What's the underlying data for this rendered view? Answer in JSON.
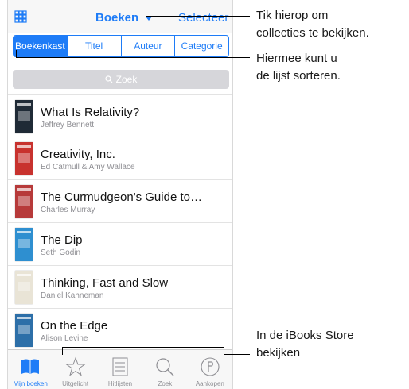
{
  "navbar": {
    "title": "Boeken",
    "right_button": "Selecteer"
  },
  "segments": [
    {
      "label": "Boekenkast",
      "active": true
    },
    {
      "label": "Titel",
      "active": false
    },
    {
      "label": "Auteur",
      "active": false
    },
    {
      "label": "Categorie",
      "active": false
    }
  ],
  "search": {
    "placeholder": "Zoek"
  },
  "books": [
    {
      "title": "What Is Relativity?",
      "author": "Jeffrey Bennett",
      "cover_color": "#1f2a36"
    },
    {
      "title": "Creativity, Inc.",
      "author": "Ed Catmull & Amy Wallace",
      "cover_color": "#c8322e"
    },
    {
      "title": "The Curmudgeon's Guide to…",
      "author": "Charles Murray",
      "cover_color": "#b73a3a"
    },
    {
      "title": "The Dip",
      "author": "Seth Godin",
      "cover_color": "#2e8fd0"
    },
    {
      "title": "Thinking, Fast and Slow",
      "author": "Daniel Kahneman",
      "cover_color": "#e9e4d6"
    },
    {
      "title": "On the Edge",
      "author": "Alison Levine",
      "cover_color": "#2d6fa8"
    }
  ],
  "tabs": [
    {
      "label": "Mijn boeken",
      "icon": "book-icon",
      "active": true
    },
    {
      "label": "Uitgelicht",
      "icon": "star-icon",
      "active": false
    },
    {
      "label": "Hitlijsten",
      "icon": "list-icon",
      "active": false
    },
    {
      "label": "Zoek",
      "icon": "search-icon",
      "active": false
    },
    {
      "label": "Aankopen",
      "icon": "purchases-icon",
      "active": false
    }
  ],
  "callouts": {
    "collections_line1": "Tik hierop om",
    "collections_line2": "collecties te bekijken.",
    "sort_line1": "Hiermee kunt u",
    "sort_line2": "de lijst sorteren.",
    "store_line1": "In de iBooks Store",
    "store_line2": "bekijken"
  },
  "colors": {
    "accent": "#1e7cf7",
    "inactive": "#8e8e93"
  }
}
